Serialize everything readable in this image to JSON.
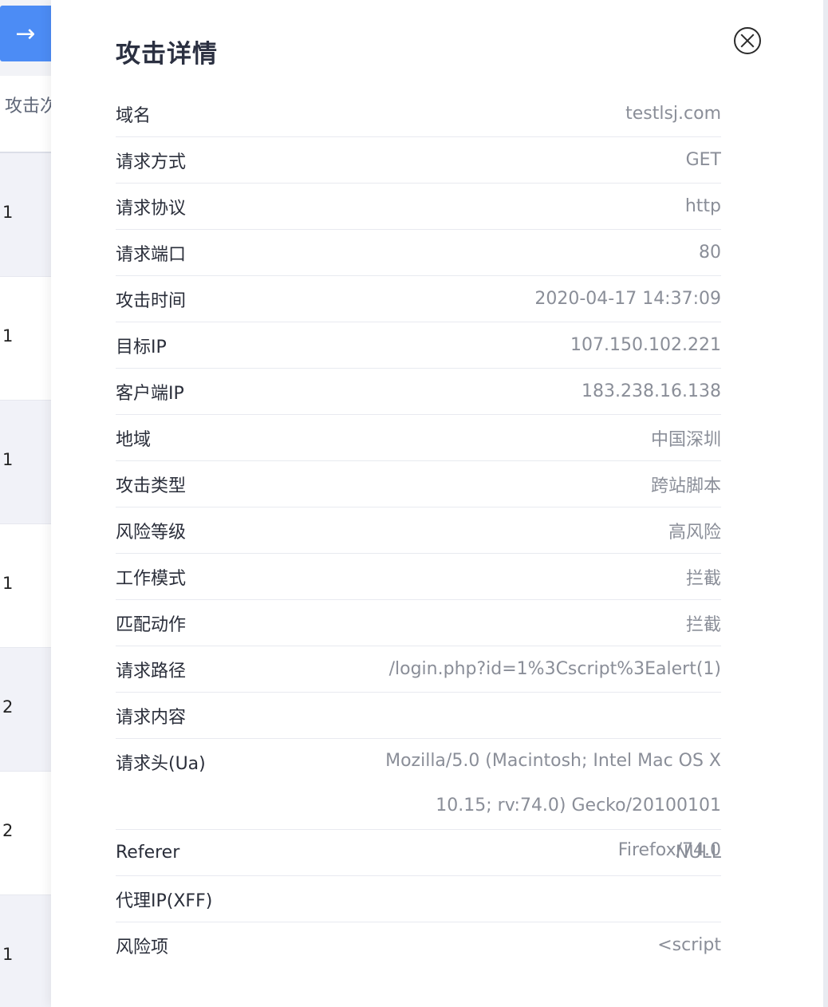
{
  "background": {
    "arrow_icon": "arrow-right-icon",
    "arrow_glyph": "→",
    "column_header": "攻击次",
    "rows": [
      "1",
      "1",
      "1",
      "1",
      "2",
      "2",
      "1"
    ]
  },
  "drawer": {
    "title": "攻击详情",
    "close_icon": "close-circle-icon",
    "details": [
      {
        "label": "域名",
        "value": "testlsj.com"
      },
      {
        "label": "请求方式",
        "value": "GET"
      },
      {
        "label": "请求协议",
        "value": "http"
      },
      {
        "label": "请求端口",
        "value": "80"
      },
      {
        "label": "攻击时间",
        "value": "2020-04-17 14:37:09"
      },
      {
        "label": "目标IP",
        "value": "107.150.102.221"
      },
      {
        "label": "客户端IP",
        "value": "183.238.16.138"
      },
      {
        "label": "地域",
        "value": "中国深圳"
      },
      {
        "label": "攻击类型",
        "value": "跨站脚本"
      },
      {
        "label": "风险等级",
        "value": "高风险"
      },
      {
        "label": "工作模式",
        "value": "拦截"
      },
      {
        "label": "匹配动作",
        "value": "拦截"
      },
      {
        "label": "请求路径",
        "value": "/login.php?id=1%3Cscript%3Ealert(1)"
      },
      {
        "label": "请求内容",
        "value": ""
      },
      {
        "label": "请求头(Ua)",
        "value": "Mozilla/5.0 (Macintosh; Intel Mac OS X 10.15; rv:74.0) Gecko/20100101 Firefox/74.0"
      },
      {
        "label": "Referer",
        "value": "NULL"
      },
      {
        "label": "代理IP(XFF)",
        "value": ""
      },
      {
        "label": "风险项",
        "value": "<script"
      }
    ]
  }
}
